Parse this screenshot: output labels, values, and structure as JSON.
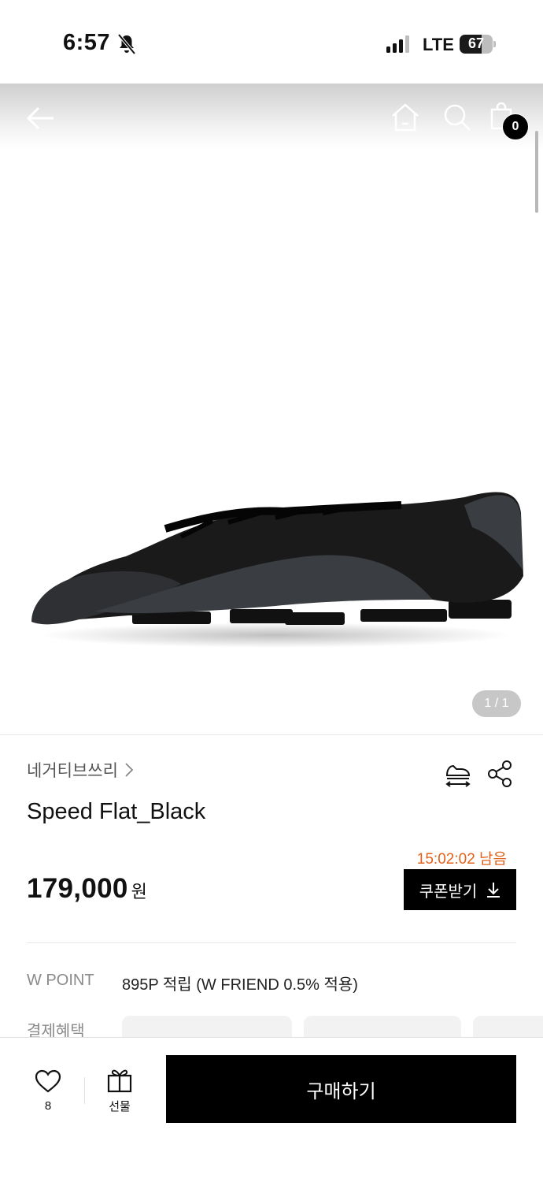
{
  "status_bar": {
    "time": "6:57",
    "network": "LTE",
    "battery_level": "67",
    "battery_fraction": 0.67
  },
  "nav": {
    "cart_count": "0"
  },
  "gallery": {
    "pager": "1 / 1"
  },
  "product": {
    "brand": "네거티브쓰리",
    "title": "Speed Flat_Black",
    "countdown": "15:02:02 남음",
    "price": "179,000",
    "price_unit": "원",
    "coupon_label": "쿠폰받기"
  },
  "points": {
    "label": "W POINT",
    "value": "895P 적립 (W FRIEND 0.5% 적용)"
  },
  "benefits": {
    "label": "결제혜택"
  },
  "bottom_bar": {
    "like_count": "8",
    "gift_label": "선물",
    "buy_label": "구매하기"
  },
  "colors": {
    "accent_countdown": "#e2611a",
    "primary_button": "#000000"
  },
  "icons": [
    "bell-off-icon",
    "signal-icon",
    "battery-icon",
    "back-arrow-icon",
    "home-icon",
    "search-icon",
    "cart-icon",
    "chevron-right-icon",
    "size-fit-icon",
    "share-icon",
    "download-icon",
    "heart-icon",
    "gift-icon"
  ]
}
